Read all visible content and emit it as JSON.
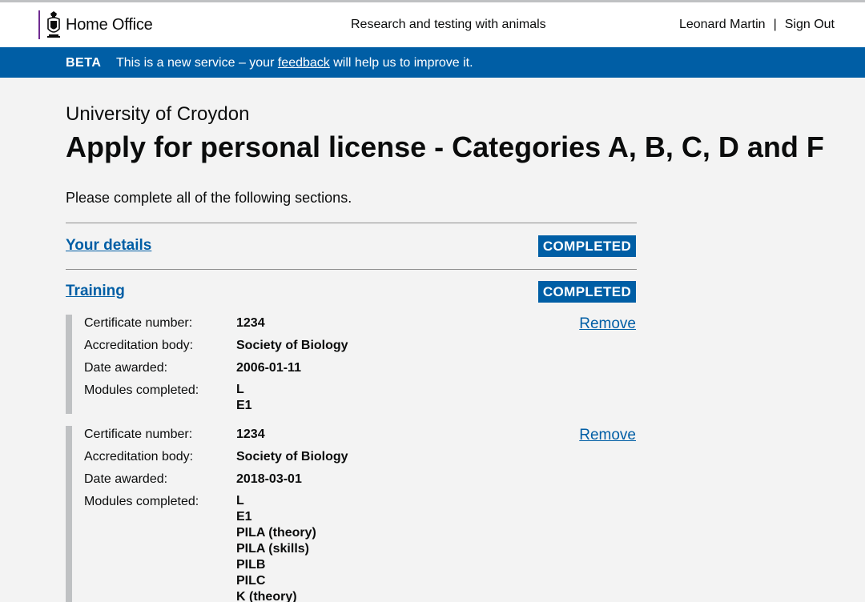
{
  "header": {
    "org": "Home Office",
    "service": "Research and testing with animals",
    "user_name": "Leonard Martin",
    "separator": "|",
    "sign_out": "Sign Out"
  },
  "beta": {
    "tag": "BETA",
    "msg_before": "This is a new service – your",
    "feedback_link": "feedback",
    "msg_after": "will help us to improve it."
  },
  "page": {
    "caption": "University of Croydon",
    "title": "Apply for personal license - Categories A, B, C, D and F",
    "intro": "Please complete all of the following sections."
  },
  "sections": [
    {
      "label": "Your details",
      "status": "COMPLETED"
    },
    {
      "label": "Training",
      "status": "COMPLETED"
    }
  ],
  "field_labels": {
    "certificate": "Certificate number:",
    "body": "Accreditation body:",
    "date": "Date awarded:",
    "modules": "Modules completed:"
  },
  "remove_label": "Remove",
  "certificates": [
    {
      "certificate": "1234",
      "body": "Society of Biology",
      "date": "2006-01-11",
      "modules": [
        "L",
        "E1"
      ]
    },
    {
      "certificate": "1234",
      "body": "Society of Biology",
      "date": "2018-03-01",
      "modules": [
        "L",
        "E1",
        "PILA (theory)",
        "PILA (skills)",
        "PILB",
        "PILC",
        "K (theory)"
      ]
    }
  ],
  "colors": {
    "brand_blue": "#005ea5",
    "home_office_purple": "#6f2c91",
    "background": "#f3f3f3"
  },
  "icons": {
    "crest": "royal-crest-icon"
  }
}
